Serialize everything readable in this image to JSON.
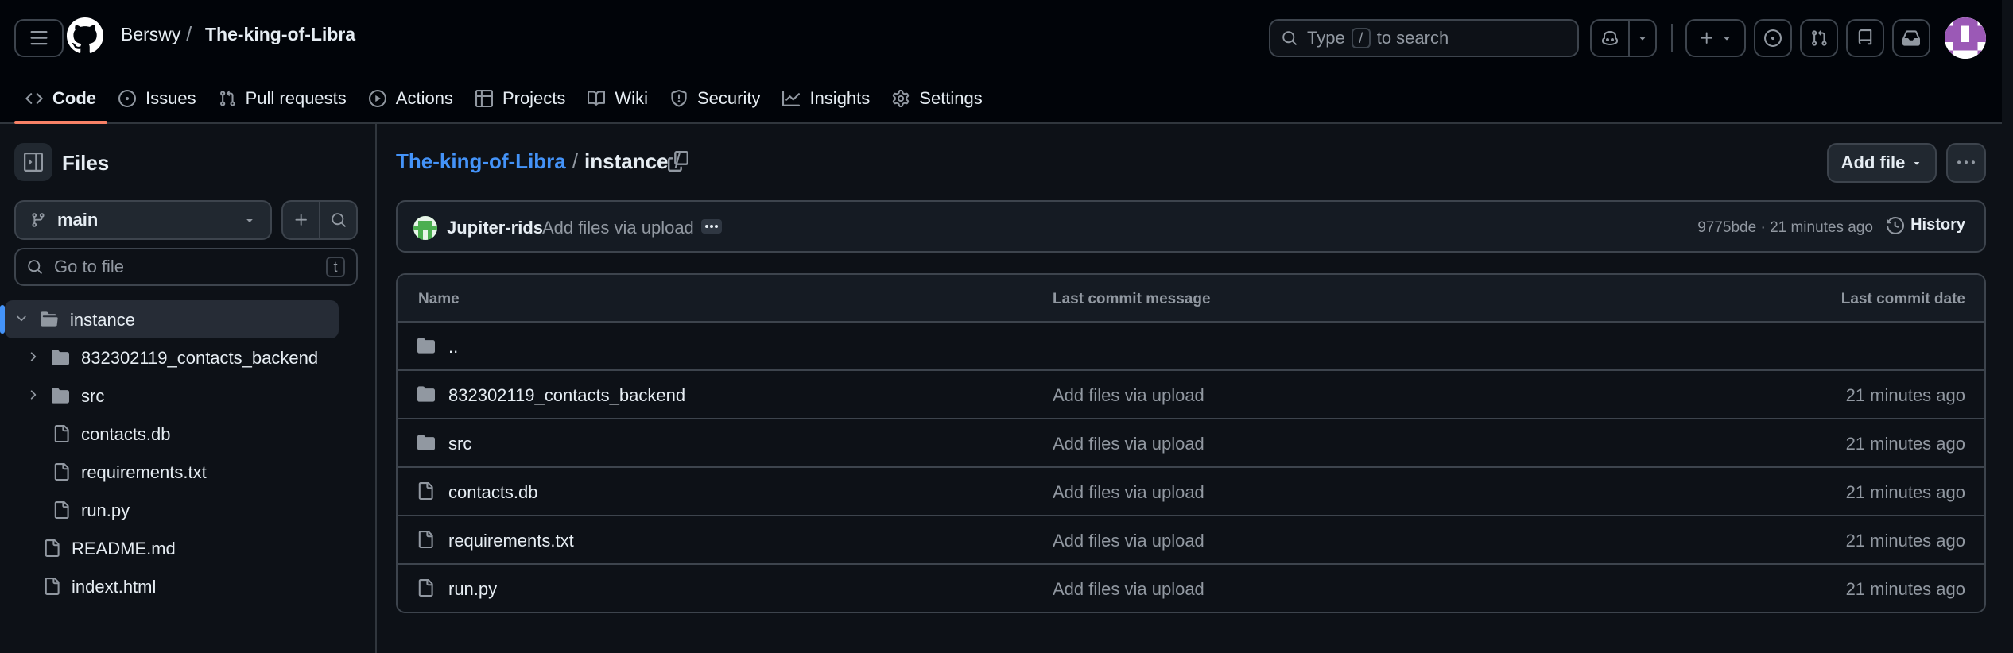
{
  "header": {
    "owner": "Berswy",
    "separator": "/",
    "repo": "The-king-of-Libra",
    "search": {
      "prefix": "Type",
      "key": "/",
      "suffix": "to search"
    }
  },
  "tabs": [
    {
      "label": "Code",
      "icon": "code-icon",
      "active": true
    },
    {
      "label": "Issues",
      "icon": "issue-icon"
    },
    {
      "label": "Pull requests",
      "icon": "pull-request-icon"
    },
    {
      "label": "Actions",
      "icon": "play-icon"
    },
    {
      "label": "Projects",
      "icon": "table-icon"
    },
    {
      "label": "Wiki",
      "icon": "book-icon"
    },
    {
      "label": "Security",
      "icon": "shield-icon"
    },
    {
      "label": "Insights",
      "icon": "graph-icon"
    },
    {
      "label": "Settings",
      "icon": "gear-icon"
    }
  ],
  "sidebar": {
    "title": "Files",
    "branch": "main",
    "goto_placeholder": "Go to file",
    "goto_key": "t",
    "tree": [
      {
        "label": "instance",
        "type": "folder",
        "expanded": true,
        "selected": true,
        "depth": 0
      },
      {
        "label": "832302119_contacts_backend",
        "type": "folder",
        "expanded": false,
        "depth": 1
      },
      {
        "label": "src",
        "type": "folder",
        "expanded": false,
        "depth": 1
      },
      {
        "label": "contacts.db",
        "type": "file",
        "depth": 1
      },
      {
        "label": "requirements.txt",
        "type": "file",
        "depth": 1
      },
      {
        "label": "run.py",
        "type": "file",
        "depth": 1
      },
      {
        "label": "README.md",
        "type": "file",
        "depth": 0
      },
      {
        "label": "indext.html",
        "type": "file",
        "depth": 0
      }
    ]
  },
  "main": {
    "path": {
      "repo": "The-king-of-Libra",
      "sep": "/",
      "current": "instance",
      "trail": "/"
    },
    "add_file_label": "Add file",
    "commit": {
      "author": "Jupiter-rids",
      "message": "Add files via upload",
      "sha_time": "9775bde · 21 minutes ago",
      "history_label": "History"
    },
    "table": {
      "headers": {
        "name": "Name",
        "message": "Last commit message",
        "date": "Last commit date"
      },
      "rows": [
        {
          "name": "..",
          "type": "folder",
          "message": "",
          "date": ""
        },
        {
          "name": "832302119_contacts_backend",
          "type": "folder",
          "message": "Add files via upload",
          "date": "21 minutes ago"
        },
        {
          "name": "src",
          "type": "folder",
          "message": "Add files via upload",
          "date": "21 minutes ago"
        },
        {
          "name": "contacts.db",
          "type": "file",
          "message": "Add files via upload",
          "date": "21 minutes ago"
        },
        {
          "name": "requirements.txt",
          "type": "file",
          "message": "Add files via upload",
          "date": "21 minutes ago"
        },
        {
          "name": "run.py",
          "type": "file",
          "message": "Add files via upload",
          "date": "21 minutes ago"
        }
      ]
    }
  },
  "colors": {
    "background": "#0d1117",
    "header_bg": "#010409",
    "accent_link": "#4493f8",
    "tab_underline": "#f78166",
    "border": "#3d444d"
  }
}
